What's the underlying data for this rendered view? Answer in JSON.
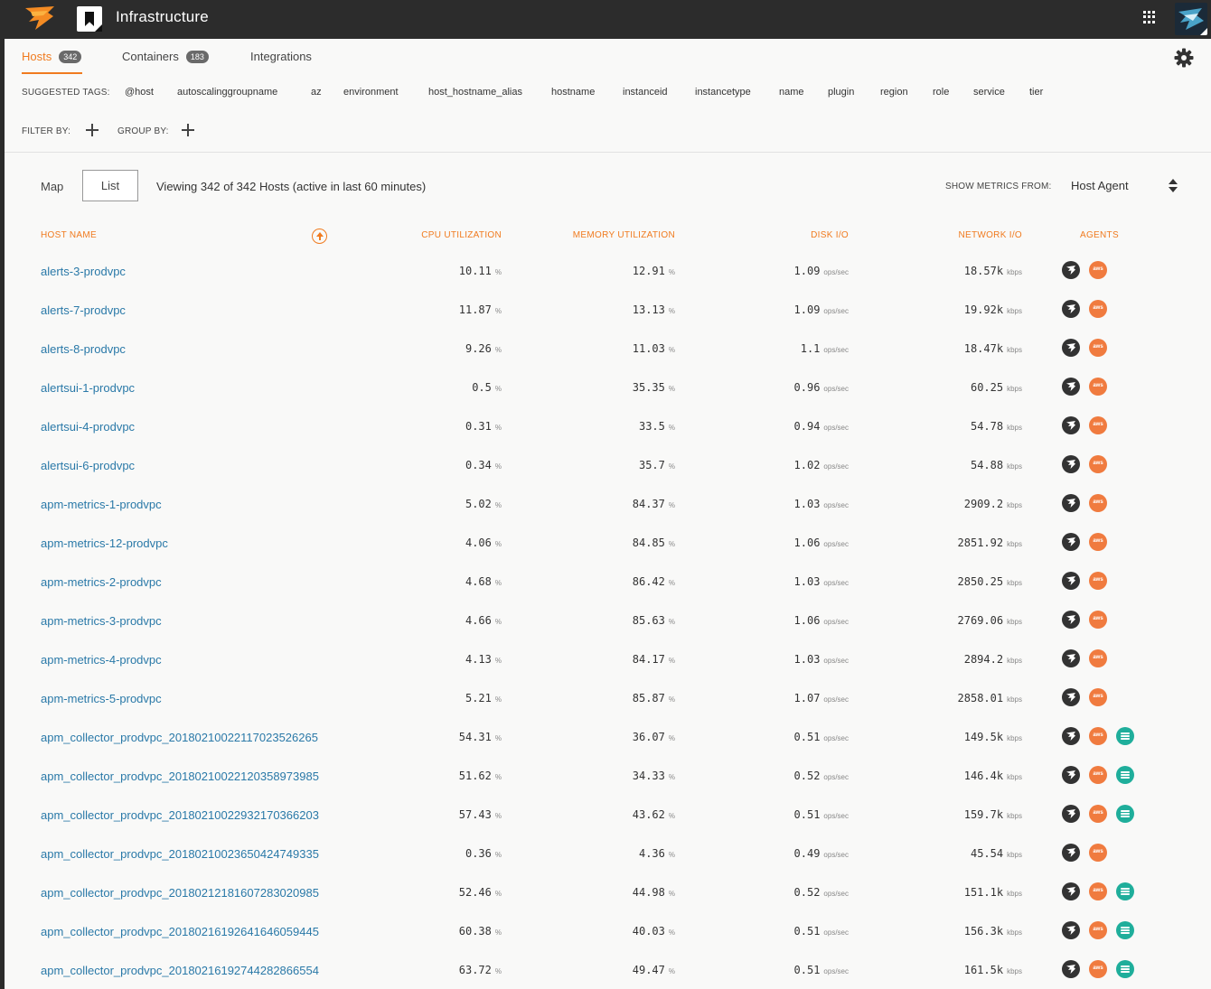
{
  "app": {
    "title": "Infrastructure"
  },
  "tabs": [
    {
      "label": "Hosts",
      "count": "342",
      "active": true
    },
    {
      "label": "Containers",
      "count": "183",
      "active": false
    },
    {
      "label": "Integrations",
      "count": null,
      "active": false
    }
  ],
  "suggested_tags": {
    "label": "SUGGESTED TAGS:",
    "items": [
      "@host",
      "autoscalinggroupname",
      "az",
      "environment",
      "host_hostname_alias",
      "hostname",
      "instanceid",
      "instancetype",
      "name",
      "plugin",
      "region",
      "role",
      "service",
      "tier"
    ]
  },
  "filter": {
    "filter_label": "FILTER BY:",
    "group_label": "GROUP BY:"
  },
  "view": {
    "map_label": "Map",
    "list_label": "List",
    "viewing_text": "Viewing 342 of 342 Hosts (active in last 60 minutes)",
    "metrics_label": "SHOW METRICS FROM:",
    "metrics_value": "Host Agent"
  },
  "table": {
    "headers": {
      "host": "HOST NAME",
      "cpu": "CPU UTILIZATION",
      "memory": "MEMORY UTILIZATION",
      "disk": "DISK I/O",
      "network": "NETWORK I/O",
      "agents": "AGENTS"
    },
    "units": {
      "cpu": "%",
      "memory": "%",
      "disk": "ops/sec",
      "network": "kbps"
    },
    "rows": [
      {
        "host": "alerts-3-prodvpc",
        "cpu": "10.11",
        "mem": "12.91",
        "disk": "1.09",
        "net": "18.57k",
        "agents": [
          "solarwinds",
          "aws"
        ]
      },
      {
        "host": "alerts-7-prodvpc",
        "cpu": "11.87",
        "mem": "13.13",
        "disk": "1.09",
        "net": "19.92k",
        "agents": [
          "solarwinds",
          "aws"
        ]
      },
      {
        "host": "alerts-8-prodvpc",
        "cpu": "9.26",
        "mem": "11.03",
        "disk": "1.1",
        "net": "18.47k",
        "agents": [
          "solarwinds",
          "aws"
        ]
      },
      {
        "host": "alertsui-1-prodvpc",
        "cpu": "0.5",
        "mem": "35.35",
        "disk": "0.96",
        "net": "60.25",
        "agents": [
          "solarwinds",
          "aws"
        ]
      },
      {
        "host": "alertsui-4-prodvpc",
        "cpu": "0.31",
        "mem": "33.5",
        "disk": "0.94",
        "net": "54.78",
        "agents": [
          "solarwinds",
          "aws"
        ]
      },
      {
        "host": "alertsui-6-prodvpc",
        "cpu": "0.34",
        "mem": "35.7",
        "disk": "1.02",
        "net": "54.88",
        "agents": [
          "solarwinds",
          "aws"
        ]
      },
      {
        "host": "apm-metrics-1-prodvpc",
        "cpu": "5.02",
        "mem": "84.37",
        "disk": "1.03",
        "net": "2909.2",
        "agents": [
          "solarwinds",
          "aws"
        ]
      },
      {
        "host": "apm-metrics-12-prodvpc",
        "cpu": "4.06",
        "mem": "84.85",
        "disk": "1.06",
        "net": "2851.92",
        "agents": [
          "solarwinds",
          "aws"
        ]
      },
      {
        "host": "apm-metrics-2-prodvpc",
        "cpu": "4.68",
        "mem": "86.42",
        "disk": "1.03",
        "net": "2850.25",
        "agents": [
          "solarwinds",
          "aws"
        ]
      },
      {
        "host": "apm-metrics-3-prodvpc",
        "cpu": "4.66",
        "mem": "85.63",
        "disk": "1.06",
        "net": "2769.06",
        "agents": [
          "solarwinds",
          "aws"
        ]
      },
      {
        "host": "apm-metrics-4-prodvpc",
        "cpu": "4.13",
        "mem": "84.17",
        "disk": "1.03",
        "net": "2894.2",
        "agents": [
          "solarwinds",
          "aws"
        ]
      },
      {
        "host": "apm-metrics-5-prodvpc",
        "cpu": "5.21",
        "mem": "85.87",
        "disk": "1.07",
        "net": "2858.01",
        "agents": [
          "solarwinds",
          "aws"
        ]
      },
      {
        "host": "apm_collector_prodvpc_20180210022117023526265",
        "cpu": "54.31",
        "mem": "36.07",
        "disk": "0.51",
        "net": "149.5k",
        "agents": [
          "solarwinds",
          "aws",
          "integration"
        ]
      },
      {
        "host": "apm_collector_prodvpc_20180210022120358973985",
        "cpu": "51.62",
        "mem": "34.33",
        "disk": "0.52",
        "net": "146.4k",
        "agents": [
          "solarwinds",
          "aws",
          "integration"
        ]
      },
      {
        "host": "apm_collector_prodvpc_20180210022932170366203",
        "cpu": "57.43",
        "mem": "43.62",
        "disk": "0.51",
        "net": "159.7k",
        "agents": [
          "solarwinds",
          "aws",
          "integration"
        ]
      },
      {
        "host": "apm_collector_prodvpc_20180210023650424749335",
        "cpu": "0.36",
        "mem": "4.36",
        "disk": "0.49",
        "net": "45.54",
        "agents": [
          "solarwinds",
          "aws"
        ]
      },
      {
        "host": "apm_collector_prodvpc_20180212181607283020985",
        "cpu": "52.46",
        "mem": "44.98",
        "disk": "0.52",
        "net": "151.1k",
        "agents": [
          "solarwinds",
          "aws",
          "integration"
        ]
      },
      {
        "host": "apm_collector_prodvpc_20180216192641646059445",
        "cpu": "60.38",
        "mem": "40.03",
        "disk": "0.51",
        "net": "156.3k",
        "agents": [
          "solarwinds",
          "aws",
          "integration"
        ]
      },
      {
        "host": "apm_collector_prodvpc_20180216192744282866554",
        "cpu": "63.72",
        "mem": "49.47",
        "disk": "0.51",
        "net": "161.5k",
        "agents": [
          "solarwinds",
          "aws",
          "integration"
        ]
      }
    ]
  },
  "icons": {
    "aws_badge_text": "aws",
    "accent_color": "#f07b1f",
    "link_color": "#2a79a8"
  }
}
